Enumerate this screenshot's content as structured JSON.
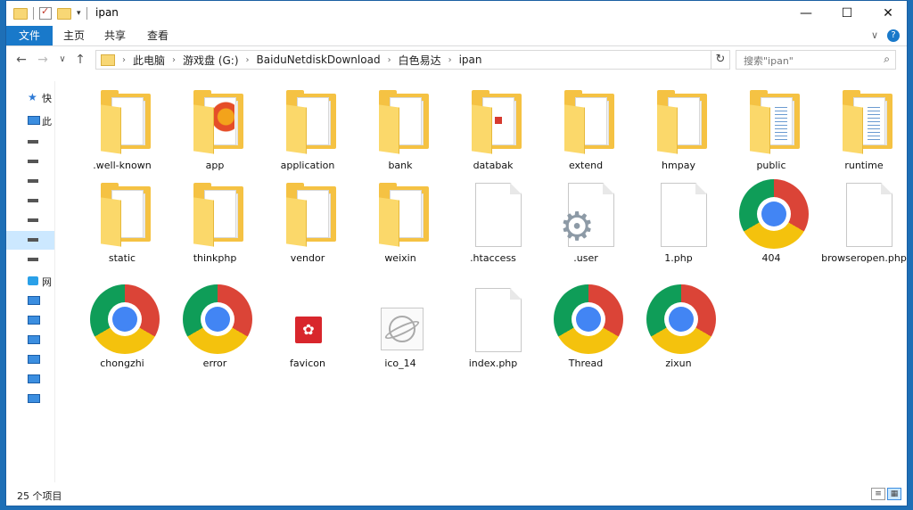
{
  "window": {
    "title": "ipan"
  },
  "caption": {
    "minimize": "—",
    "maximize": "☐",
    "close": "✕"
  },
  "ribbon": {
    "tabs": [
      "文件",
      "主页",
      "共享",
      "查看"
    ],
    "expand": "∨",
    "help": "?"
  },
  "nav": {
    "back": "←",
    "forward": "→",
    "recent": "∨",
    "up": "↑",
    "breadcrumbs": [
      "此电脑",
      "游戏盘 (G:)",
      "BaiduNetdiskDownload",
      "白色易达",
      "ipan"
    ],
    "refresh": "↻",
    "search_placeholder": "搜索\"ipan\""
  },
  "sidebar": {
    "items": [
      {
        "label": "快",
        "icon": "star-icon"
      },
      {
        "label": "此",
        "icon": "computer-icon"
      },
      {
        "label": "",
        "icon": "drive-icon"
      },
      {
        "label": "",
        "icon": "drive-icon"
      },
      {
        "label": "",
        "icon": "drive-icon"
      },
      {
        "label": "",
        "icon": "drive-icon"
      },
      {
        "label": "",
        "icon": "drive-icon"
      },
      {
        "label": "",
        "icon": "drive-icon",
        "selected": true
      },
      {
        "label": "",
        "icon": "drive-icon"
      },
      {
        "label": "网",
        "icon": "network-icon"
      },
      {
        "label": "",
        "icon": "monitor-icon"
      },
      {
        "label": "",
        "icon": "monitor-icon"
      },
      {
        "label": "",
        "icon": "monitor-icon"
      },
      {
        "label": "",
        "icon": "monitor-icon"
      },
      {
        "label": "",
        "icon": "monitor-icon"
      },
      {
        "label": "",
        "icon": "monitor-icon"
      }
    ]
  },
  "files": [
    {
      "name": ".well-known",
      "type": "folder"
    },
    {
      "name": "app",
      "type": "folder-badge"
    },
    {
      "name": "application",
      "type": "folder"
    },
    {
      "name": "bank",
      "type": "folder"
    },
    {
      "name": "databak",
      "type": "folder-small"
    },
    {
      "name": "extend",
      "type": "folder"
    },
    {
      "name": "hmpay",
      "type": "folder"
    },
    {
      "name": "public",
      "type": "folder-stripe"
    },
    {
      "name": "runtime",
      "type": "folder-stripe"
    },
    {
      "name": "static",
      "type": "folder"
    },
    {
      "name": "thinkphp",
      "type": "folder"
    },
    {
      "name": "vendor",
      "type": "folder"
    },
    {
      "name": "weixin",
      "type": "folder"
    },
    {
      "name": ".htaccess",
      "type": "file"
    },
    {
      "name": ".user",
      "type": "file-gear"
    },
    {
      "name": "1.php",
      "type": "file"
    },
    {
      "name": "404",
      "type": "chrome"
    },
    {
      "name": "browseropen.php",
      "type": "file"
    },
    {
      "name": "chongzhi",
      "type": "chrome"
    },
    {
      "name": "error",
      "type": "chrome"
    },
    {
      "name": "favicon",
      "type": "favicon"
    },
    {
      "name": "ico_14",
      "type": "ico"
    },
    {
      "name": "index.php",
      "type": "file"
    },
    {
      "name": "Thread",
      "type": "chrome"
    },
    {
      "name": "zixun",
      "type": "chrome"
    }
  ],
  "status": {
    "count": "25 个项目",
    "details_view": "≡",
    "icons_view": "▦"
  }
}
